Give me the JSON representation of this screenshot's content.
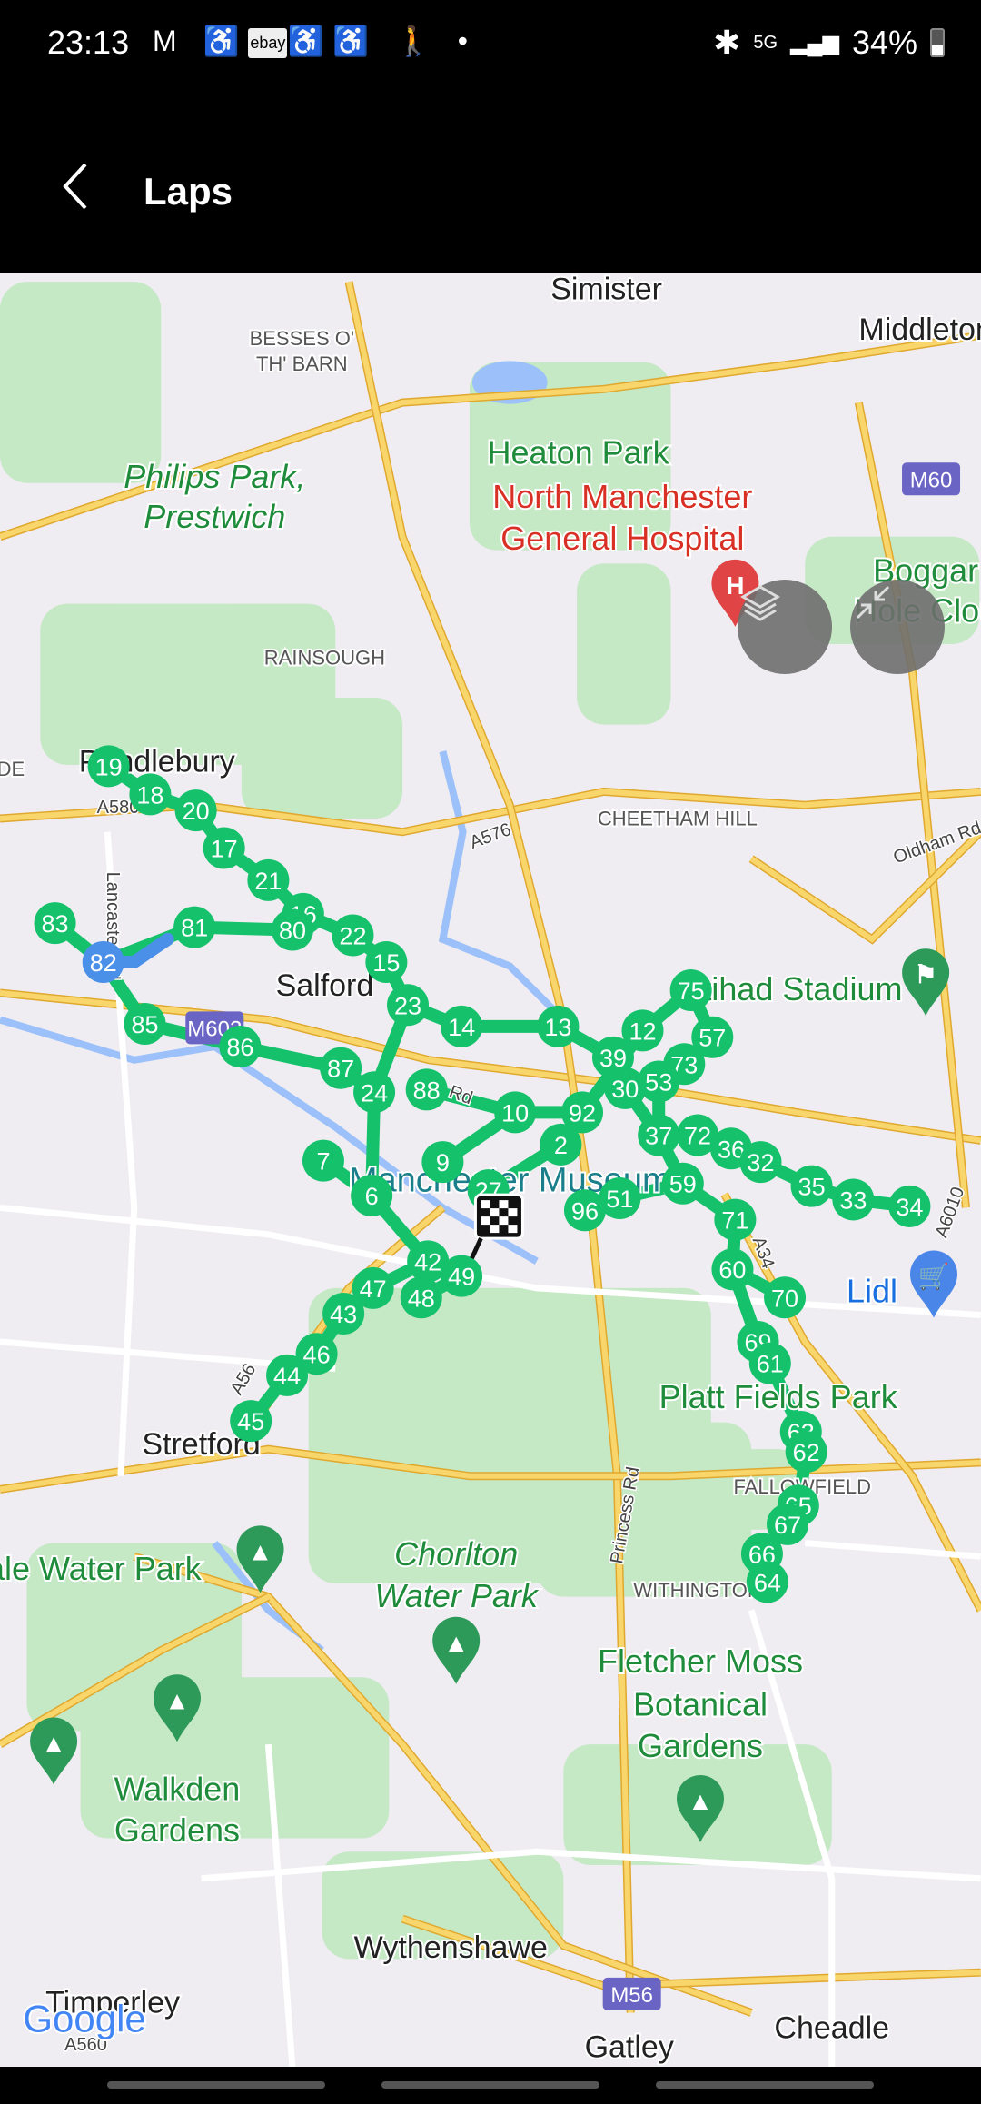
{
  "status_bar": {
    "time": "23:13",
    "notification_icons": [
      "gmail-icon",
      "app-icon",
      "ebay-icon",
      "app-icon",
      "app-icon",
      "accessibility-icon",
      "dot-icon"
    ],
    "ebay_label": "ebay",
    "network": "5G",
    "battery": "34%"
  },
  "header": {
    "title": "Laps",
    "back_icon": "chevron-left-icon"
  },
  "map_controls": {
    "layers_icon": "layers-icon",
    "collapse_icon": "collapse-icon"
  },
  "colors": {
    "route": "#15c26b",
    "selected_lap": "#4a90e8",
    "map_bg": "#efedf2",
    "road_major": "#f5c242",
    "park": "#c5e8c5"
  },
  "laps": {
    "labels": [
      "19",
      "18",
      "20",
      "17",
      "21",
      "16",
      "80",
      "81",
      "22",
      "15",
      "83",
      "82",
      "85",
      "86",
      "87",
      "23",
      "14",
      "24",
      "88",
      "13",
      "10",
      "2",
      "92",
      "9",
      "7",
      "6",
      "27",
      "39",
      "12",
      "75",
      "57",
      "73",
      "53",
      "30",
      "37",
      "72",
      "36",
      "32",
      "35",
      "33",
      "34",
      "59",
      "51",
      "96",
      "71",
      "60",
      "70",
      "42",
      "49",
      "47",
      "48",
      "43",
      "46",
      "44",
      "45",
      "69",
      "61",
      "63",
      "62",
      "65",
      "67",
      "66",
      "64"
    ],
    "selected": "82",
    "finish_icon": "checkered-flag-icon"
  },
  "places": [
    {
      "t": "Simister",
      "c": "dark"
    },
    {
      "t": "BESSES O'",
      "c": "caps"
    },
    {
      "t": "TH' BARN",
      "c": "caps"
    },
    {
      "t": "Philips Park,",
      "c": "park"
    },
    {
      "t": "Prestwich",
      "c": "park"
    },
    {
      "t": "Heaton Park",
      "c": "park2"
    },
    {
      "t": "North Manchester",
      "c": "red"
    },
    {
      "t": "General Hospital",
      "c": "red"
    },
    {
      "t": "Boggar",
      "c": "park2"
    },
    {
      "t": "Hole Clou",
      "c": "park2"
    },
    {
      "t": "RAINSOUGH",
      "c": "caps"
    },
    {
      "t": "Pendlebury",
      "c": "dark"
    },
    {
      "t": "CHEETHAM HILL",
      "c": "caps"
    },
    {
      "t": "Salford",
      "c": "dark"
    },
    {
      "t": "Etihad Stadium",
      "c": "park2"
    },
    {
      "t": "Manchester Museum",
      "c": "teal"
    },
    {
      "t": "Lidl",
      "c": "blue"
    },
    {
      "t": "Platt Fields Park",
      "c": "park2"
    },
    {
      "t": "Stretford",
      "c": "dark"
    },
    {
      "t": "FALLOWFIELD",
      "c": "caps"
    },
    {
      "t": "Chorlton",
      "c": "park"
    },
    {
      "t": "Water Park",
      "c": "park"
    },
    {
      "t": "ale Water Park",
      "c": "park2"
    },
    {
      "t": "WITHINGTON",
      "c": "caps"
    },
    {
      "t": "Fletcher Moss",
      "c": "park2"
    },
    {
      "t": "Botanical",
      "c": "park2"
    },
    {
      "t": "Gardens",
      "c": "park2"
    },
    {
      "t": "Walkden",
      "c": "park2"
    },
    {
      "t": "Gardens",
      "c": "park2"
    },
    {
      "t": "Wythenshawe",
      "c": "dark"
    },
    {
      "t": "Timperley",
      "c": "dark"
    },
    {
      "t": "Cheadle",
      "c": "dark"
    },
    {
      "t": "Gatley",
      "c": "dark"
    },
    {
      "t": "Middleton",
      "c": "dark"
    },
    {
      "t": "IDE",
      "c": "caps"
    }
  ],
  "road_labels": [
    "A580",
    "A576",
    "Oldham Rd",
    "Lancaster Rd",
    "Rd",
    "A34",
    "A6010",
    "Princess Rd",
    "A56",
    "A560"
  ],
  "motorway_shields": [
    "M60",
    "M602",
    "M56"
  ],
  "attribution": "Google"
}
